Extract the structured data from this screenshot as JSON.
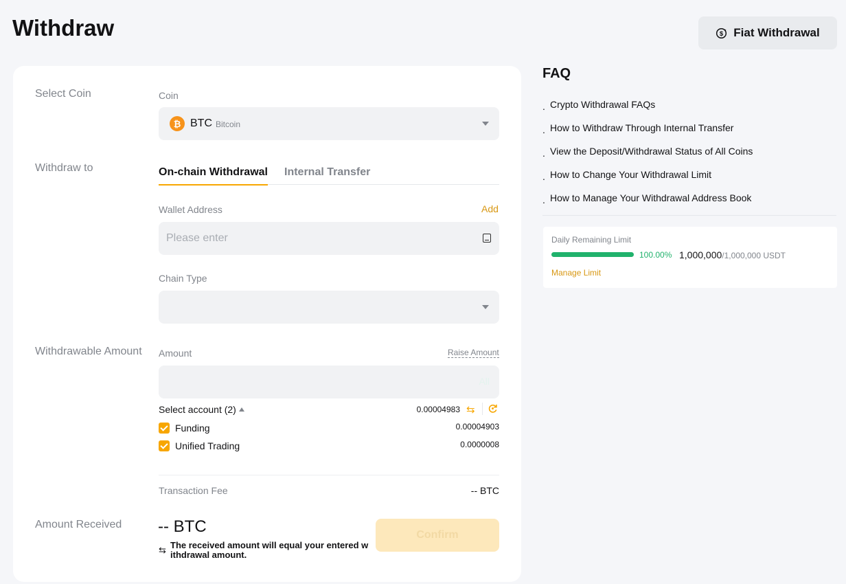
{
  "header": {
    "title": "Withdraw",
    "fiat_button_label": "Fiat Withdrawal"
  },
  "form": {
    "sections": {
      "select_coin": "Select Coin",
      "withdraw_to": "Withdraw to",
      "withdrawable_amount": "Withdrawable Amount",
      "amount_received": "Amount Received"
    },
    "coin": {
      "label": "Coin",
      "icon_letter": "₿",
      "symbol": "BTC",
      "name": "Bitcoin"
    },
    "tabs": [
      {
        "label": "On-chain Withdrawal",
        "active": true
      },
      {
        "label": "Internal Transfer",
        "active": false
      }
    ],
    "wallet_address": {
      "label": "Wallet Address",
      "add_label": "Add",
      "placeholder": "Please enter",
      "value": ""
    },
    "chain_type": {
      "label": "Chain Type",
      "value": ""
    },
    "amount": {
      "label": "Amount",
      "raise_label": "Raise Amount",
      "value": "",
      "all_label": "All"
    },
    "accounts": {
      "select_label": "Select account (2)",
      "total_balance": "0.00004983",
      "items": [
        {
          "name": "Funding",
          "value": "0.00004903",
          "checked": true
        },
        {
          "name": "Unified Trading",
          "value": "0.0000008",
          "checked": true
        }
      ]
    },
    "fee": {
      "label": "Transaction Fee",
      "value": "-- BTC"
    },
    "received": {
      "value": "-- BTC",
      "note_icon": "⇆",
      "note": "The received amount will equal your entered withdrawal amount."
    },
    "confirm_label": "Confirm"
  },
  "faq": {
    "title": "FAQ",
    "items": [
      "Crypto Withdrawal FAQs",
      "How to Withdraw Through Internal Transfer",
      "View the Deposit/Withdrawal Status of All Coins",
      "How to Change Your Withdrawal Limit",
      "How to Manage Your Withdrawal Address Book"
    ]
  },
  "limit": {
    "label": "Daily Remaining Limit",
    "progress_fraction": 1.0,
    "percent_text": "100.00%",
    "remaining": "1,000,000",
    "total": "/1,000,000 USDT",
    "manage_label": "Manage Limit"
  },
  "colors": {
    "accent": "#f7a600",
    "link": "#d89712",
    "success": "#20b26c"
  }
}
